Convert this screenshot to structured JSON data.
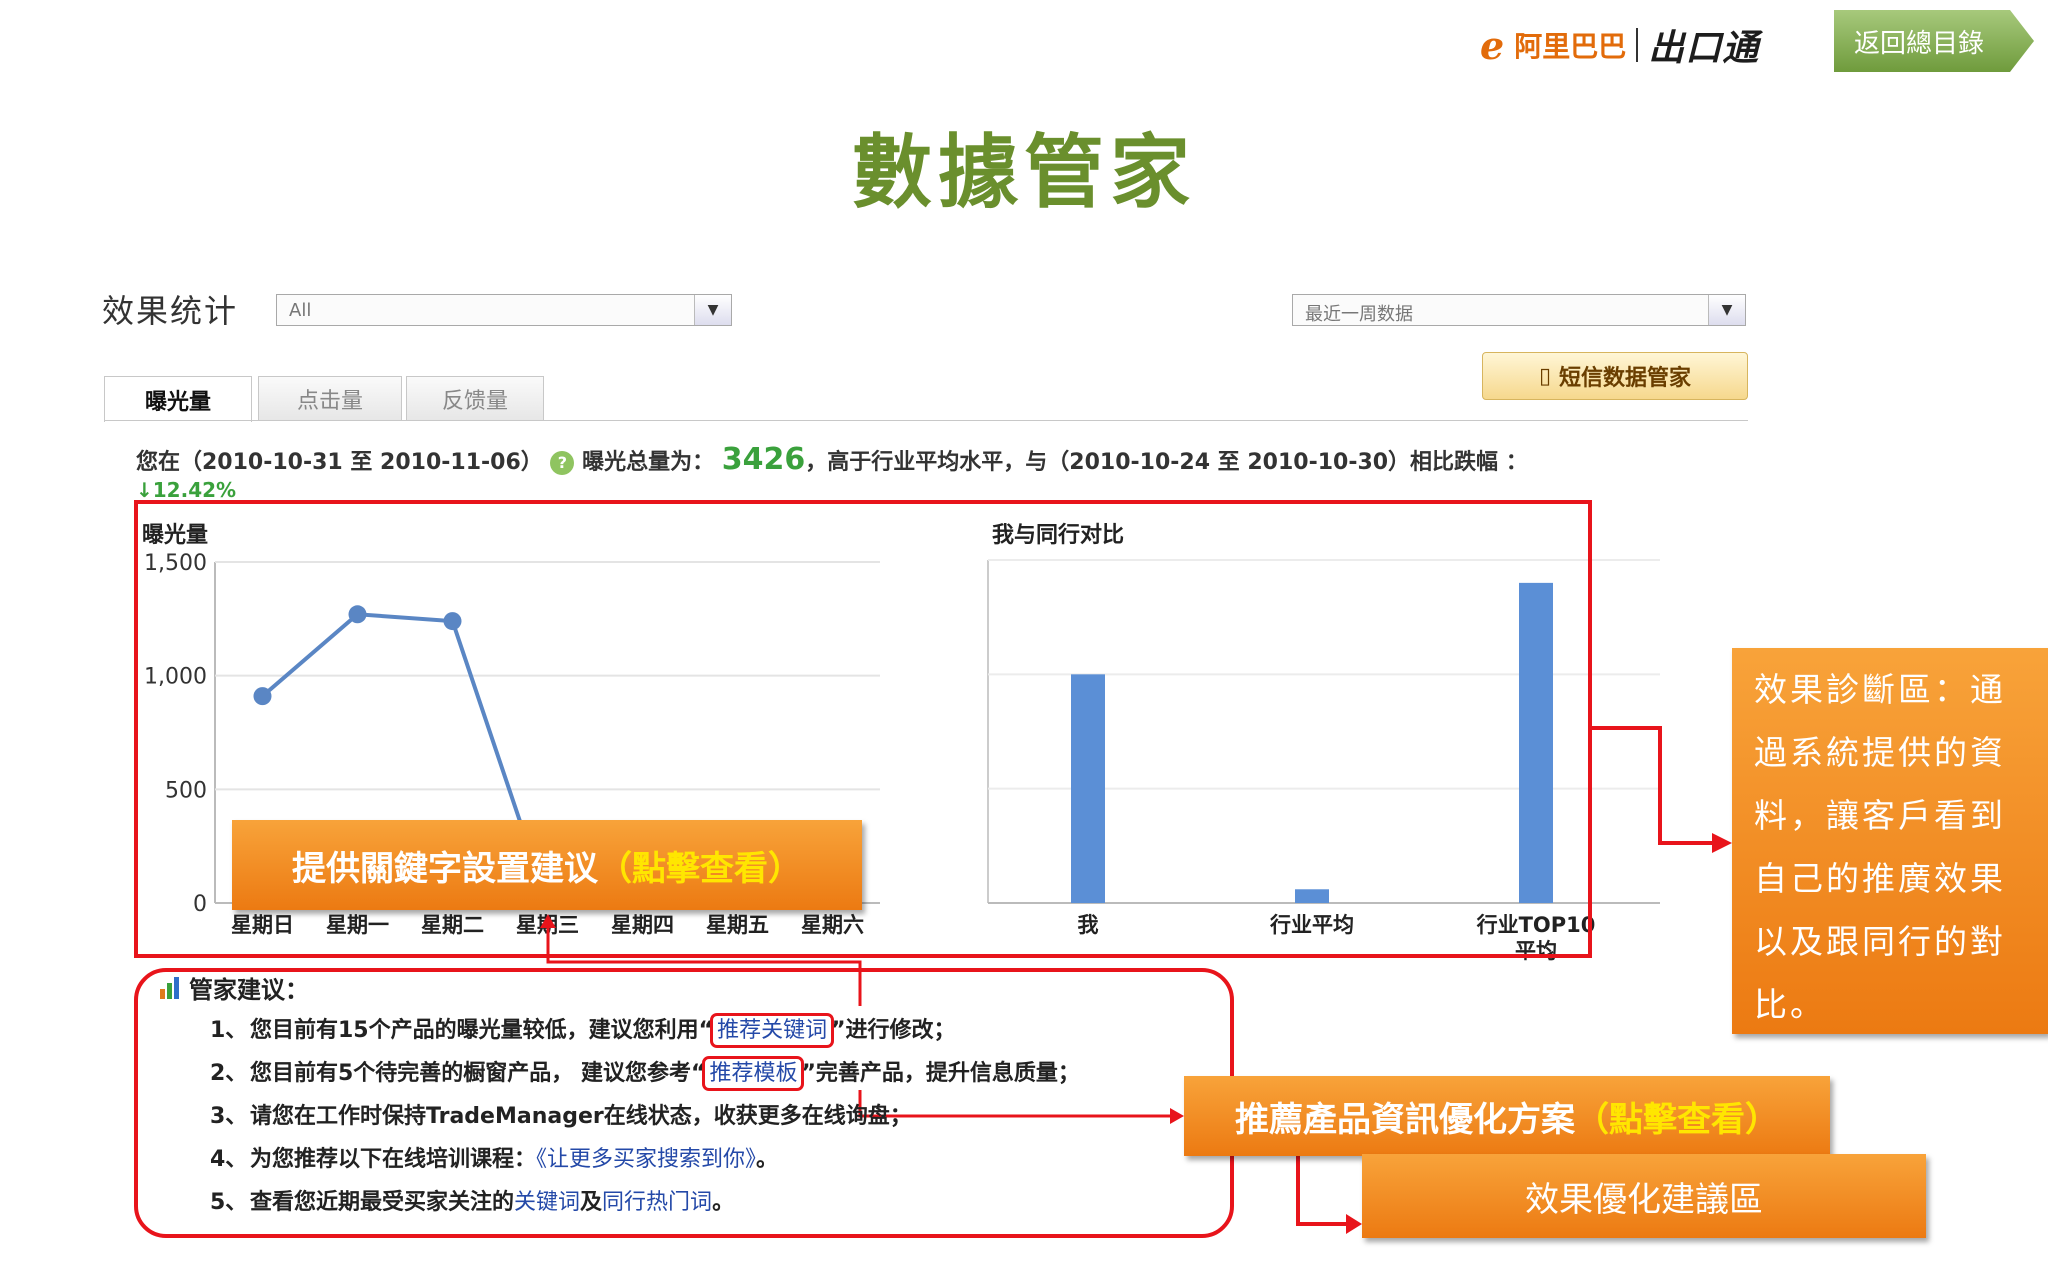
{
  "header": {
    "logo_mark": "e",
    "logo_alibaba": "阿里巴巴",
    "logo_product": "出口通",
    "back_button": "返回總目錄",
    "page_title": "數據管家"
  },
  "toolbar": {
    "stats_label": "效果统计",
    "category_select": "All",
    "period_select": "最近一周数据",
    "sms_button": "短信数据管家"
  },
  "tabs": [
    {
      "label": "曝光量",
      "active": true
    },
    {
      "label": "点击量",
      "active": false
    },
    {
      "label": "反馈量",
      "active": false
    }
  ],
  "summary": {
    "prefix": "您在（2010-10-31 至 2010-11-06）",
    "q_icon": "?",
    "total_label": "曝光总量为：",
    "total_value": "3426",
    "suffix": "，高于行业平均水平，与（2010-10-24 至 2010-10-30）相比跌幅 ：",
    "change": "↓12.42%"
  },
  "chart_data": [
    {
      "type": "line",
      "title": "曝光量",
      "categories": [
        "星期日",
        "星期一",
        "星期二",
        "星期三",
        "星期四",
        "星期五",
        "星期六"
      ],
      "series": [
        {
          "values": [
            910,
            1270,
            1240,
            0,
            null,
            null,
            null
          ]
        }
      ],
      "y_ticks": [
        "1,500",
        "1,000",
        "500",
        "0"
      ],
      "ylim": [
        0,
        1500
      ],
      "grid": true
    },
    {
      "type": "bar",
      "title": "我与同行对比",
      "categories": [
        "我",
        "行业平均",
        "行业TOP10平均"
      ],
      "values": [
        1000,
        60,
        1400
      ],
      "ylim": [
        0,
        1500
      ],
      "grid": true
    }
  ],
  "advice": {
    "title": "管家建议：",
    "items": [
      {
        "num": "1、",
        "pre": "您目前有15个产品的曝光量较低，建议您利用“",
        "link": "推荐关键词",
        "post": "”进行修改；"
      },
      {
        "num": "2、",
        "pre": "您目前有5个待完善的橱窗产品， 建议您参考“",
        "link": "推荐模板",
        "post": "”完善产品，提升信息质量；"
      },
      {
        "num": "3、",
        "pre": "请您在工作时保持TradeManager在线状态，收获更多在线询盘；",
        "link": "",
        "post": ""
      },
      {
        "num": "4、",
        "pre": "为您推荐以下在线培训课程：",
        "link": "《让更多买家搜索到你》",
        "post": "。"
      },
      {
        "num": "5、",
        "pre": "查看您近期最受买家关注的",
        "link": "关键词",
        "mid": "及",
        "link2": "同行热门词",
        "post": "。"
      }
    ]
  },
  "callouts": {
    "keyword_main": "提供關鍵字設置建议",
    "keyword_action": "（點擊查看）",
    "recommend_main": "推薦產品資訊優化方案",
    "recommend_action": "（點擊查看）",
    "optimize_area": "效果優化建議區",
    "diagnosis_area": "效果診斷區：通過系統提供的資料，讓客戶看到自己的推廣效果以及跟同行的對比。"
  },
  "colors": {
    "title_green": "#6a8f2d",
    "callout_orange": "#ec7a12",
    "highlight_yellow": "#ffe600",
    "annotation_red": "#e8141b",
    "bar_blue": "#5b8fd6",
    "line_blue": "#5a86c4"
  }
}
